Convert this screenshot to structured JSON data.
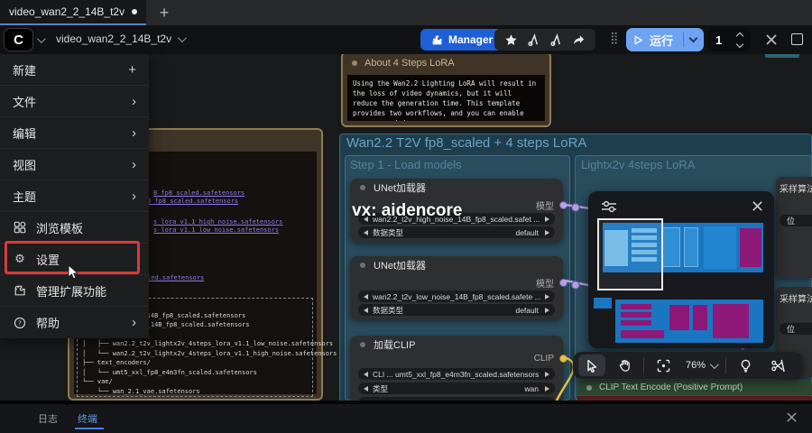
{
  "colors": {
    "manager_blue": "#1e5fd6",
    "run_blue": "#6fa3f2",
    "annotation_red": "#d93a3a",
    "group_teal": "#2a4d5e",
    "wire_purple": "#b4a1e6",
    "wire_yellow": "#e3c44d",
    "minimap_blue": "#1b76c2",
    "minimap_magenta": "#8e1878",
    "terminal_tab_blue": "#6a97e8"
  },
  "tab_bar": {
    "active_tab": "video_wan2_2_14B_t2v",
    "new_tab_label": "+"
  },
  "toolbar": {
    "workflow_name": "video_wan2_2_14B_t2v",
    "manager_label": "Manager",
    "run_label": "运行",
    "queue_count": "1"
  },
  "menu": {
    "items": [
      {
        "label": "新建",
        "accessory": "+"
      },
      {
        "label": "文件",
        "accessory": "›"
      },
      {
        "label": "编辑",
        "accessory": "›"
      },
      {
        "label": "视图",
        "accessory": "›"
      },
      {
        "label": "主题",
        "accessory": "›"
      },
      {
        "label": "浏览模板",
        "accessory": ""
      },
      {
        "label": "设置",
        "accessory": ""
      },
      {
        "label": "管理扩展功能",
        "accessory": ""
      },
      {
        "label": "帮助",
        "accessory": "›"
      }
    ]
  },
  "canvas": {
    "watermark": "vx: aidencore",
    "groups": {
      "outer_title": "Wan2.2 T2V fp8_scaled +  4 steps LoRA",
      "step1_title": "Step 1 - Load models",
      "lightx2v_title": "Lightx2v 4steps LoRA"
    },
    "about_note": {
      "title": "About 4 Steps LoRA",
      "body": "Using the Wan2.2 Lighting LoRA will result in the loss of video dynamics, but it will reduce the generation time. This template provides two workflows, and you can enable one as needed."
    },
    "left_note": {
      "links": [
        "B_fp8_scaled.safetensors",
        "8_fp8_scaled.safetensors",
        "s_lora_v1.1_high_noise.safetensors",
        "s_lora_v1.1_low_noise.safetensors",
        "led.safetensors"
      ],
      "tree": "els/\n│      low_noise_14B_fp8_scaled.safetensors\n│      high_noise_14B_fp8_scaled.safetensors\n├── loras/\n│   ├── wan2.2_t2v_lightx2v_4steps_lora_v1.1_low_noise.safetensors\n│   └── wan2.2_t2v_lightx2v_4steps_lora_v1.1_high_noise.safetensors\n├── text_encoders/\n│   └── umt5_xxl_fp8_e4m3fn_scaled.safetensors\n└── vae/\n    └── wan_2.1_vae.safetensors"
    },
    "nodes": {
      "unet1": {
        "title": "UNet加载器",
        "output": "模型",
        "widget1": "wan2.2_t2v_high_noise_14B_fp8_scaled.safet ...",
        "widget2_label": "数据类型",
        "widget2_value": "default"
      },
      "unet2": {
        "title": "UNet加载器",
        "output": "模型",
        "widget1": "wan2.2_t2v_low_noise_14B_fp8_scaled.safete ...",
        "widget2_label": "数据类型",
        "widget2_value": "default"
      },
      "clip": {
        "title": "加载CLIP",
        "output": "CLIP",
        "widget1": "CLI ... umt5_xxl_fp8_e4m3fn_scaled.safetensors",
        "widget2_label": "类型",
        "widget2_value": "wan"
      },
      "clip_text_encode": {
        "title": "CLIP Text Encode (Positive Prompt)"
      },
      "sampler_fragment1": {
        "title": "采样算法 (",
        "widget": "位"
      },
      "sampler_fragment2": {
        "title": "采样算法 (",
        "widget": "位"
      }
    },
    "zoom_toolbar": {
      "zoom_level": "76%"
    }
  },
  "bottom_panel": {
    "tabs": [
      {
        "label": "日志"
      },
      {
        "label": "终端"
      }
    ]
  }
}
